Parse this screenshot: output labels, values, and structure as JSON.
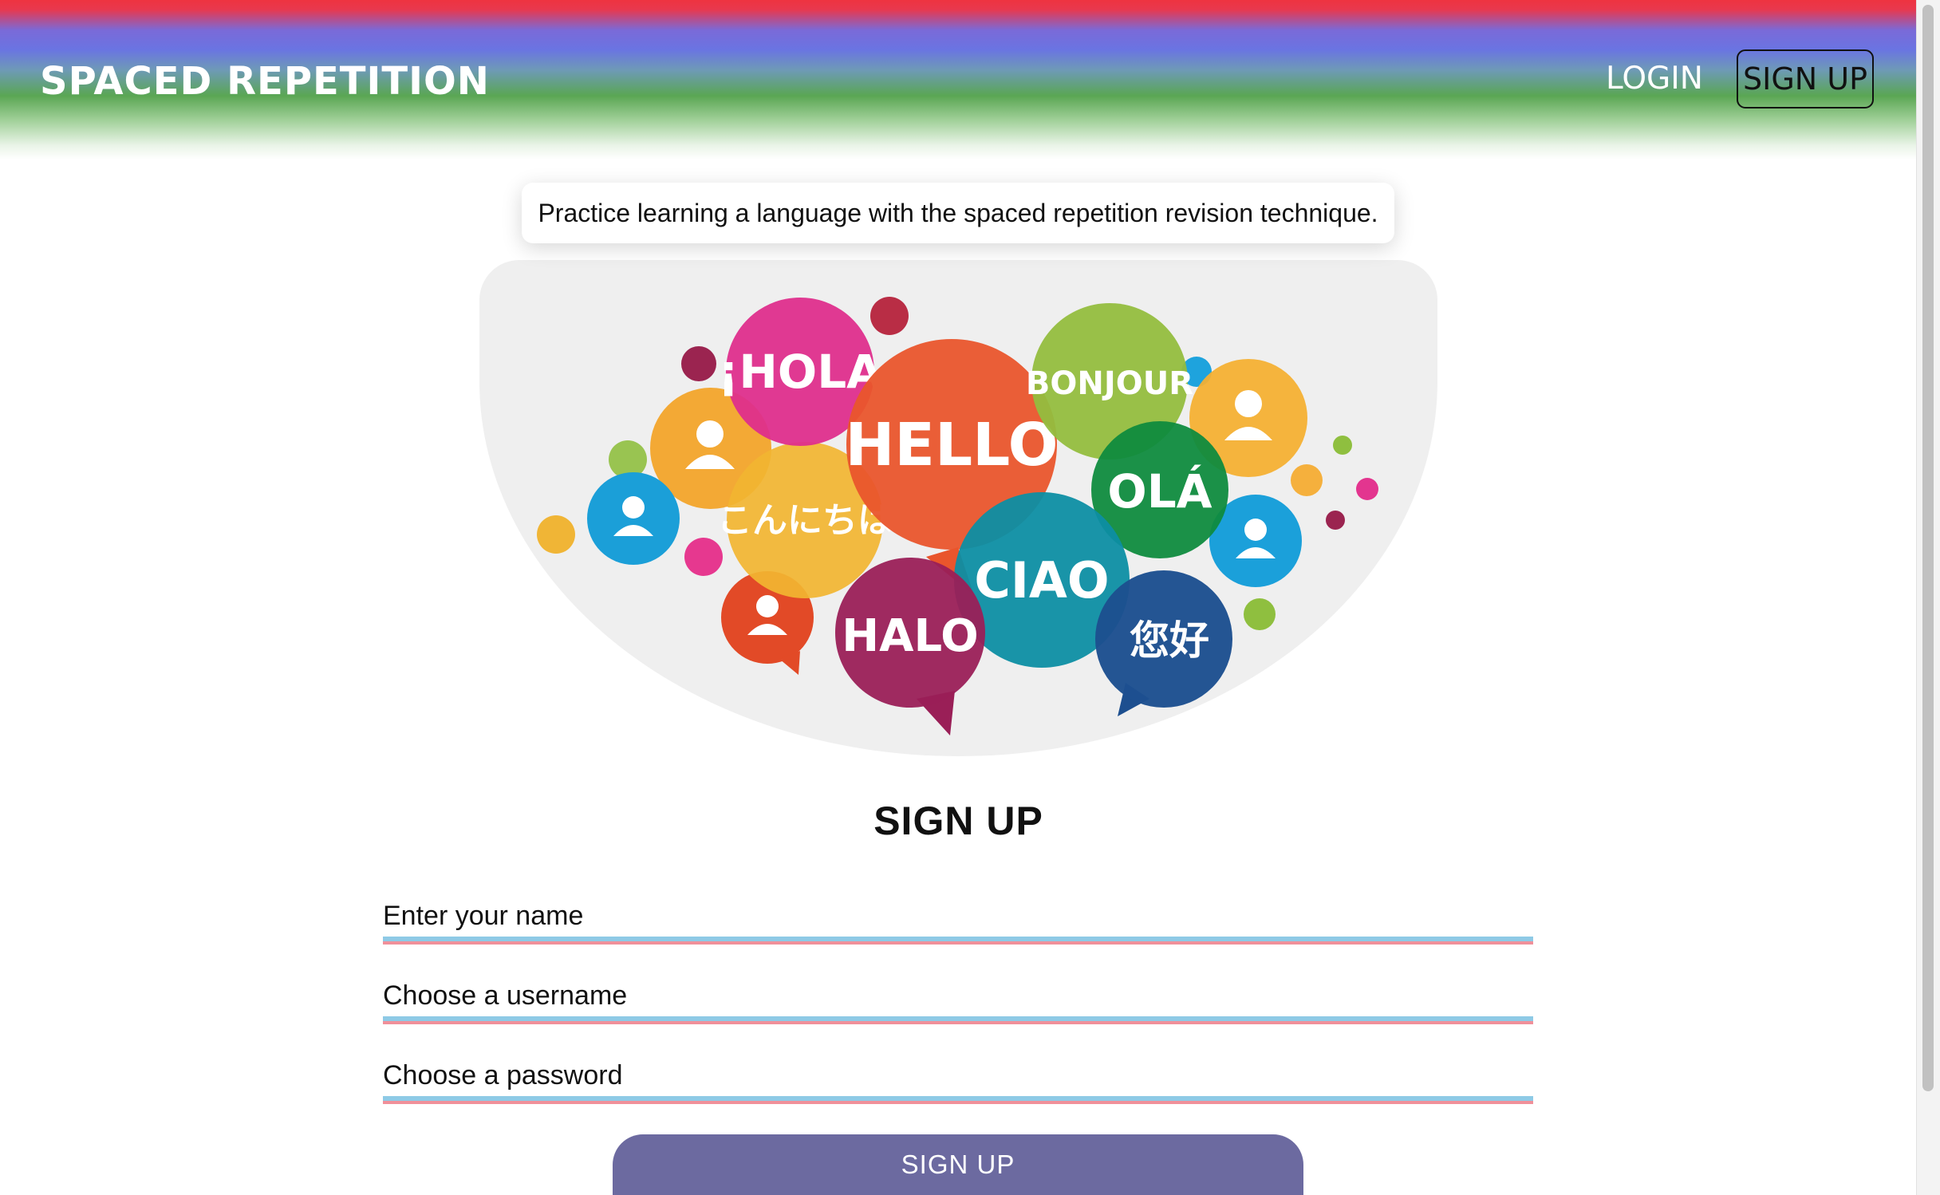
{
  "header": {
    "brand": "SPACED REPETITION",
    "login_label": "LOGIN",
    "signup_label": "SIGN UP"
  },
  "hero": {
    "tagline": "Practice learning a language with the spaced repetition revision technique.",
    "image_words": [
      "¡HOLA",
      "HELLO",
      "BONJOUR",
      "OLÁ",
      "こんにちは",
      "CIAO",
      "HALO",
      "您好"
    ]
  },
  "form": {
    "title": "SIGN UP",
    "fields": [
      {
        "label": "Enter your name",
        "value": ""
      },
      {
        "label": "Choose a username",
        "value": ""
      },
      {
        "label": "Choose a password",
        "value": ""
      }
    ],
    "submit_label": "SIGN UP"
  },
  "colors": {
    "header_red": "#ee3340",
    "header_blue": "#6a74e2",
    "header_green": "#5aa653",
    "submit_bg": "#6c6aa0",
    "input_blue": "#8ecae6",
    "input_pink": "#f0909a"
  }
}
